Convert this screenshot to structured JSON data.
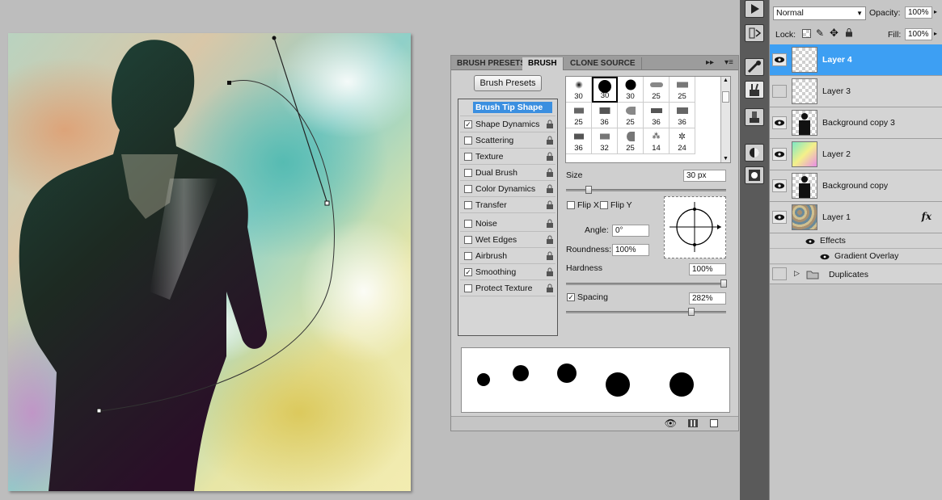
{
  "brush_panel": {
    "tabs": [
      "BRUSH PRESETS",
      "BRUSH",
      "CLONE SOURCE"
    ],
    "active_tab": "BRUSH",
    "presets_button": "Brush Presets",
    "options": [
      {
        "label": "Brush Tip Shape",
        "checked": null,
        "selected": true
      },
      {
        "label": "Shape Dynamics",
        "checked": true
      },
      {
        "label": "Scattering",
        "checked": false
      },
      {
        "label": "Texture",
        "checked": false
      },
      {
        "label": "Dual Brush",
        "checked": false
      },
      {
        "label": "Color Dynamics",
        "checked": false
      },
      {
        "label": "Transfer",
        "checked": false
      },
      {
        "label": "Noise",
        "checked": false
      },
      {
        "label": "Wet Edges",
        "checked": false
      },
      {
        "label": "Airbrush",
        "checked": false
      },
      {
        "label": "Smoothing",
        "checked": true
      },
      {
        "label": "Protect Texture",
        "checked": false
      }
    ],
    "brush_sizes": [
      "30",
      "30",
      "30",
      "25",
      "25",
      "25",
      "36",
      "25",
      "36",
      "36",
      "36",
      "32",
      "25",
      "14",
      "24"
    ],
    "size_label": "Size",
    "size_value": "30 px",
    "flip_x": "Flip X",
    "flip_y": "Flip Y",
    "angle_label": "Angle:",
    "angle_value": "0°",
    "roundness_label": "Roundness:",
    "roundness_value": "100%",
    "hardness_label": "Hardness",
    "hardness_value": "100%",
    "spacing_label": "Spacing",
    "spacing_value": "282%",
    "spacing_checked": true
  },
  "options_bar": {
    "blend_mode": "Normal",
    "opacity_label": "Opacity:",
    "opacity_value": "100%",
    "lock_label": "Lock:",
    "fill_label": "Fill:",
    "fill_value": "100%"
  },
  "layers": [
    {
      "name": "Layer 4",
      "selected": true,
      "thumb": "transparent"
    },
    {
      "name": "Layer 3",
      "selected": false,
      "thumb": "transparent"
    },
    {
      "name": "Background copy 3",
      "selected": false,
      "thumb": "silhouette"
    },
    {
      "name": "Layer 2",
      "selected": false,
      "thumb": "gradient"
    },
    {
      "name": "Background copy",
      "selected": false,
      "thumb": "silhouette"
    },
    {
      "name": "Layer 1",
      "selected": false,
      "thumb": "texture",
      "fx": "fx"
    }
  ],
  "effects": {
    "label": "Effects",
    "items": [
      "Gradient Overlay"
    ]
  },
  "group": {
    "name": "Duplicates"
  },
  "colors": {
    "selection": "#3d9ff3",
    "panel": "#cfcfcf",
    "tool_strip": "#5a5a5a"
  }
}
